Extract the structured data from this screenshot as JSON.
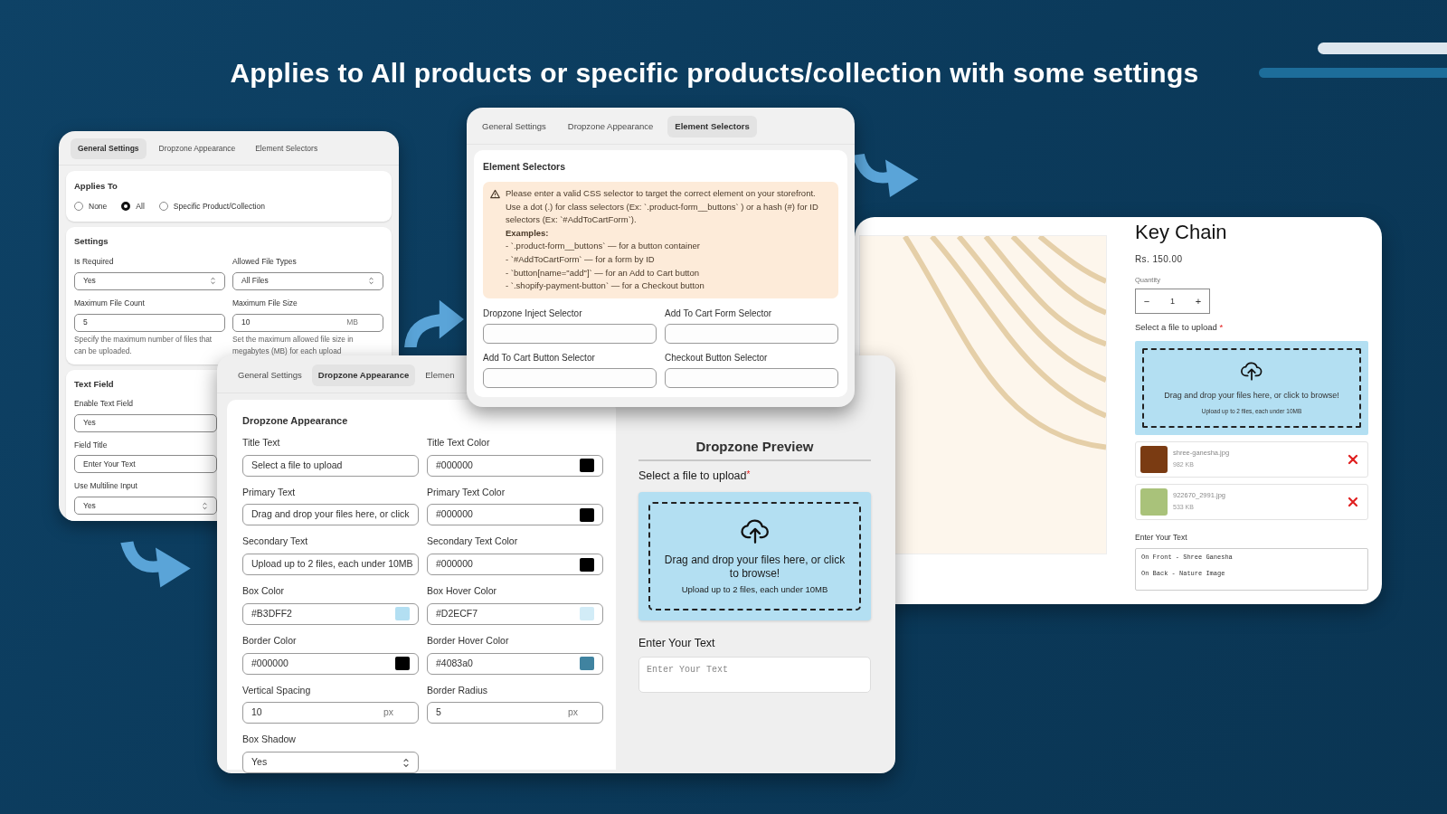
{
  "headline": "Applies to All products or specific products/collection with some settings",
  "general_panel": {
    "tabs": [
      {
        "label": "General Settings",
        "selected": true
      },
      {
        "label": "Dropzone Appearance",
        "selected": false
      },
      {
        "label": "Element Selectors",
        "selected": false
      }
    ],
    "applies_to": {
      "title": "Applies To",
      "options": [
        {
          "label": "None",
          "selected": false
        },
        {
          "label": "All",
          "selected": true
        },
        {
          "label": "Specific Product/Collection",
          "selected": false
        }
      ]
    },
    "settings": {
      "title": "Settings",
      "fields": [
        {
          "label": "Is Required",
          "kind": "select",
          "value": "Yes"
        },
        {
          "label": "Allowed File Types",
          "kind": "select",
          "value": "All Files"
        },
        {
          "label": "Maximum File Count",
          "kind": "input",
          "value": "5",
          "help": "Specify the maximum number of files that can be uploaded."
        },
        {
          "label": "Maximum File Size",
          "kind": "unit",
          "value": "10",
          "unit": "MB",
          "help": "Set the maximum allowed file size in megabytes (MB) for each upload"
        }
      ]
    },
    "text_field": {
      "title": "Text Field",
      "fields": [
        {
          "label": "Enable Text Field",
          "kind": "input",
          "value": "Yes"
        },
        {
          "label": "Field Title",
          "kind": "input",
          "value": "Enter Your Text"
        },
        {
          "label": "Use Multiline Input",
          "kind": "select",
          "value": "Yes"
        }
      ]
    }
  },
  "element_panel": {
    "tabs": [
      {
        "label": "General Settings",
        "selected": false
      },
      {
        "label": "Dropzone Appearance",
        "selected": false
      },
      {
        "label": "Element Selectors",
        "selected": true
      }
    ],
    "title": "Element Selectors",
    "notice": {
      "text": "Please enter a valid CSS selector to target the correct element on your storefront. Use a dot (.) for class selectors (Ex: `.product-form__buttons` ) or a hash (#) for ID selectors (Ex: `#AddToCartForm`).",
      "examples_title": "Examples:",
      "examples": [
        "- `.product-form__buttons` — for a button container",
        "- `#AddToCartForm` — for a form by ID",
        "- `button[name=\"add\"]` — for an Add to Cart button",
        "- `.shopify-payment-button` — for a Checkout button"
      ]
    },
    "fields": [
      {
        "label": "Dropzone Inject Selector",
        "kind": "input"
      },
      {
        "label": "Add To Cart Form Selector",
        "kind": "input"
      },
      {
        "label": "Add To Cart Button Selector",
        "kind": "input"
      },
      {
        "label": "Checkout Button Selector",
        "kind": "input"
      }
    ]
  },
  "dropzone_panel": {
    "tabs": [
      {
        "label": "General Settings",
        "selected": false
      },
      {
        "label": "Dropzone Appearance",
        "selected": true
      },
      {
        "label": "Elemen",
        "selected": false
      }
    ],
    "title": "Dropzone Appearance",
    "fields": [
      {
        "label": "Title Text",
        "kind": "input",
        "value": "Select a file to upload"
      },
      {
        "label": "Title Text Color",
        "kind": "color",
        "value": "#000000",
        "color": "#000000"
      },
      {
        "label": "Primary Text",
        "kind": "input",
        "value": "Drag and drop your files here, or click"
      },
      {
        "label": "Primary Text Color",
        "kind": "color",
        "value": "#000000",
        "color": "#000000"
      },
      {
        "label": "Secondary Text",
        "kind": "input",
        "value": "Upload up to 2 files, each under 10MB"
      },
      {
        "label": "Secondary Text Color",
        "kind": "color",
        "value": "#000000",
        "color": "#000000"
      },
      {
        "label": "Box Color",
        "kind": "color",
        "value": "#B3DFF2",
        "color": "#b3dff2"
      },
      {
        "label": "Box Hover Color",
        "kind": "color",
        "value": "#D2ECF7",
        "color": "#d2ecf7"
      },
      {
        "label": "Border Color",
        "kind": "color",
        "value": "#000000",
        "color": "#000000"
      },
      {
        "label": "Border Hover Color",
        "kind": "color",
        "value": "#4083a0",
        "color": "#4083a0"
      },
      {
        "label": "Vertical Spacing",
        "kind": "unit",
        "value": "10",
        "unit": "px"
      },
      {
        "label": "Border Radius",
        "kind": "unit",
        "value": "5",
        "unit": "px"
      },
      {
        "label": "Box Shadow",
        "kind": "select",
        "value": "Yes"
      }
    ],
    "preview": {
      "title": "Dropzone Preview",
      "upload_label": "Select a file to upload",
      "required_mark": "*",
      "primary": "Drag and drop your files here, or click to browse!",
      "secondary": "Upload up to 2 files, each under 10MB",
      "text_label": "Enter Your Text",
      "text_placeholder": "Enter Your Text"
    }
  },
  "product_page": {
    "title": "Key Chain",
    "price": "Rs. 150.00",
    "quantity_label": "Quantity",
    "quantity": {
      "minus": "−",
      "value": "1",
      "plus": "+"
    },
    "upload_label": "Select a file to upload",
    "required_mark": "*",
    "dropzone": {
      "primary": "Drag and drop your files here, or click to browse!",
      "secondary": "Upload up to 2 files, each under 10MB"
    },
    "files": [
      {
        "name": "shree-ganesha.jpg",
        "size": "982 KB"
      },
      {
        "name": "922670_2991.jpg",
        "size": "533 KB"
      }
    ],
    "text_label": "Enter Your Text",
    "text_lines": [
      "On Front - Shree Ganesha",
      "On Back - Nature Image"
    ]
  }
}
